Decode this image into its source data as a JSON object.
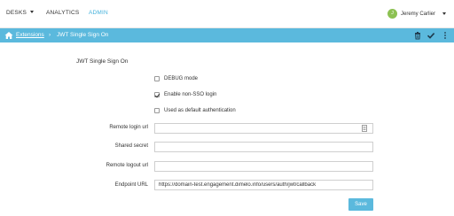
{
  "nav": {
    "items": [
      {
        "label": "DESKS"
      },
      {
        "label": "ANALYTICS"
      },
      {
        "label": "ADMIN",
        "active": true
      }
    ],
    "user": {
      "initial": "J",
      "name": "Jeremy Carlier",
      "avatar_color": "#8cc152"
    }
  },
  "breadcrumb": {
    "parent": "Extensions",
    "separator": "›",
    "current": "JWT Single Sign On",
    "bar_color": "#5bb9dd"
  },
  "form": {
    "title": "JWT Single Sign On",
    "checkboxes": [
      {
        "label": "DEBUG mode",
        "checked": false
      },
      {
        "label": "Enable non-SSO login",
        "checked": true
      },
      {
        "label": "Used as default authentication",
        "checked": false
      }
    ],
    "fields": [
      {
        "label": "Remote login url",
        "value": ""
      },
      {
        "label": "Shared secret",
        "value": ""
      },
      {
        "label": "Remote logout url",
        "value": ""
      },
      {
        "label": "Endpoint URL",
        "value": "https://domain-test.engagement.dimelo.info/users/auth/jwt/callback"
      }
    ],
    "save_label": "Save"
  },
  "colors": {
    "accent": "#5bb9dd",
    "active_nav": "#46b2dc"
  }
}
